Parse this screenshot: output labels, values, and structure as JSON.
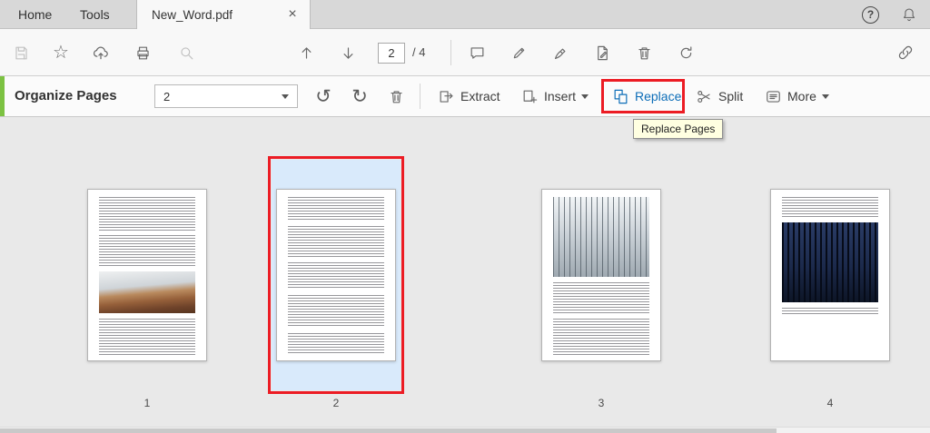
{
  "colors": {
    "accent_green": "#7cc242",
    "accent_blue": "#0e6eb8",
    "annotation_red": "#ec1c24",
    "selection_blue": "#d9eafb",
    "tooltip_yellow": "#ffffe1"
  },
  "tabbar": {
    "tabs": [
      {
        "label": "Home"
      },
      {
        "label": "Tools"
      }
    ],
    "document_tab": {
      "label": "New_Word.pdf"
    }
  },
  "glyphs": {
    "close": "×",
    "help": "?",
    "star": "☆",
    "rotate_left": "↺",
    "rotate_right": "↻"
  },
  "quick_toolbar": {
    "page_input": "2",
    "page_total": "/ 4"
  },
  "organize_toolbar": {
    "title": "Organize Pages",
    "range_value": "2",
    "extract_label": "Extract",
    "insert_label": "Insert",
    "replace_label": "Replace",
    "split_label": "Split",
    "more_label": "More"
  },
  "tooltip": {
    "label": "Replace Pages"
  },
  "pages": [
    {
      "label": "1",
      "selected": false
    },
    {
      "label": "2",
      "selected": true
    },
    {
      "label": "3",
      "selected": false
    },
    {
      "label": "4",
      "selected": false
    }
  ]
}
